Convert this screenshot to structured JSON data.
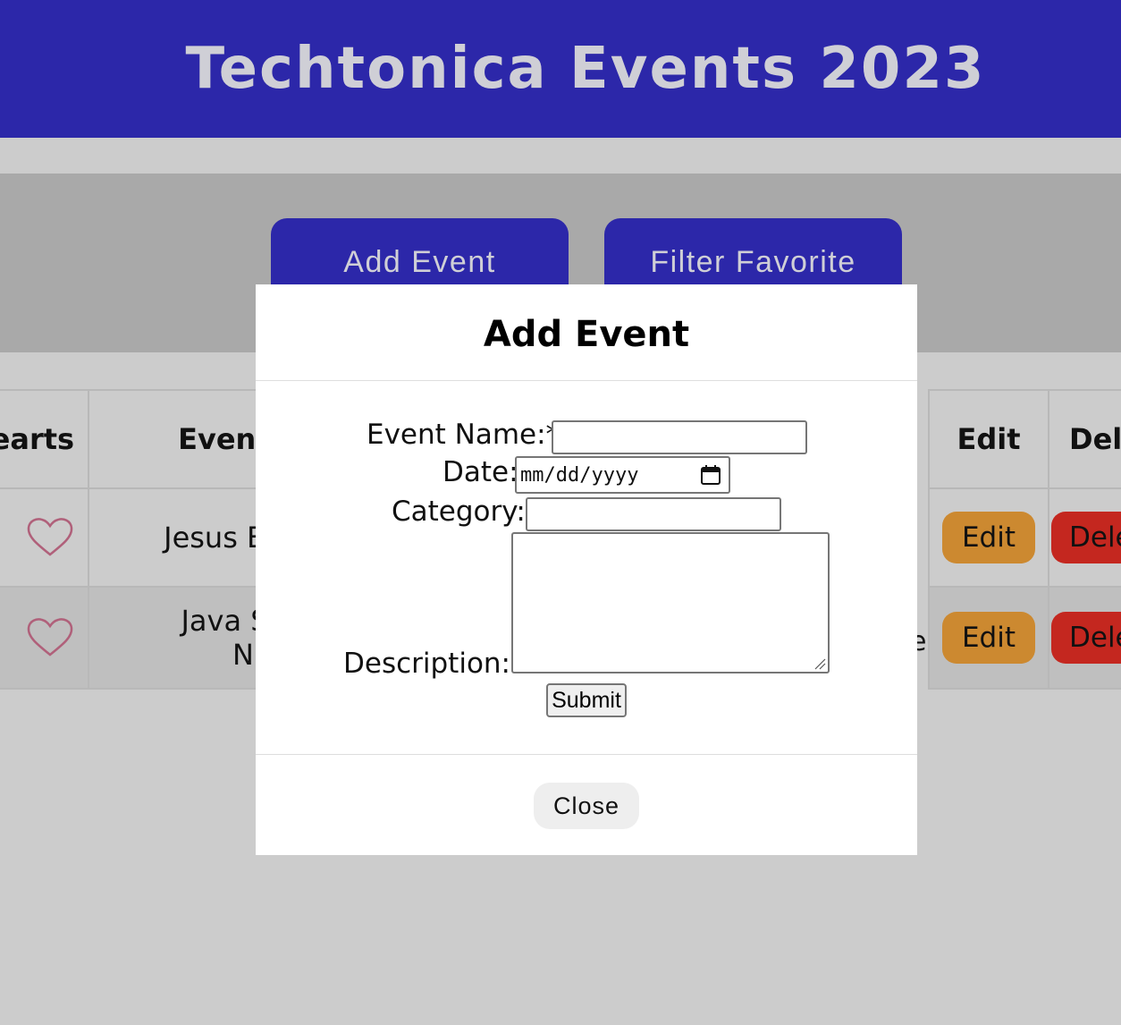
{
  "header": {
    "title": "Techtonica Events 2023"
  },
  "actions": {
    "add_event_label": "Add Event",
    "filter_favorite_label": "Filter Favorite"
  },
  "table": {
    "headers": {
      "hearts": "hearts",
      "event_name": "Event Nar",
      "edit": "Edit",
      "delete": "Dele"
    },
    "rows": [
      {
        "name": "Jesus Birth",
        "edit_label": "Edit",
        "delete_label": "Dele"
      },
      {
        "name_line1": "Java Script S",
        "name_line2": "Night",
        "edit_label": "Edit",
        "delete_label": "Dele"
      }
    ],
    "peek_text": "e"
  },
  "modal": {
    "title": "Add Event",
    "event_name_label": "Event Name:*",
    "date_label": "Date:",
    "date_placeholder": "mm/dd/yyyy",
    "category_label": "Category:",
    "description_label": "Description:",
    "submit_label": "Submit",
    "close_label": "Close"
  },
  "colors": {
    "header_bg": "#2c27a9",
    "header_text": "#cfcfd6",
    "edit_button": "#cc8930",
    "delete_button": "#c4271f",
    "heart_outline": "#b0607a"
  },
  "icons": {
    "heart": "heart-outline-icon",
    "calendar": "calendar-icon",
    "resize": "resize-grip-icon"
  }
}
